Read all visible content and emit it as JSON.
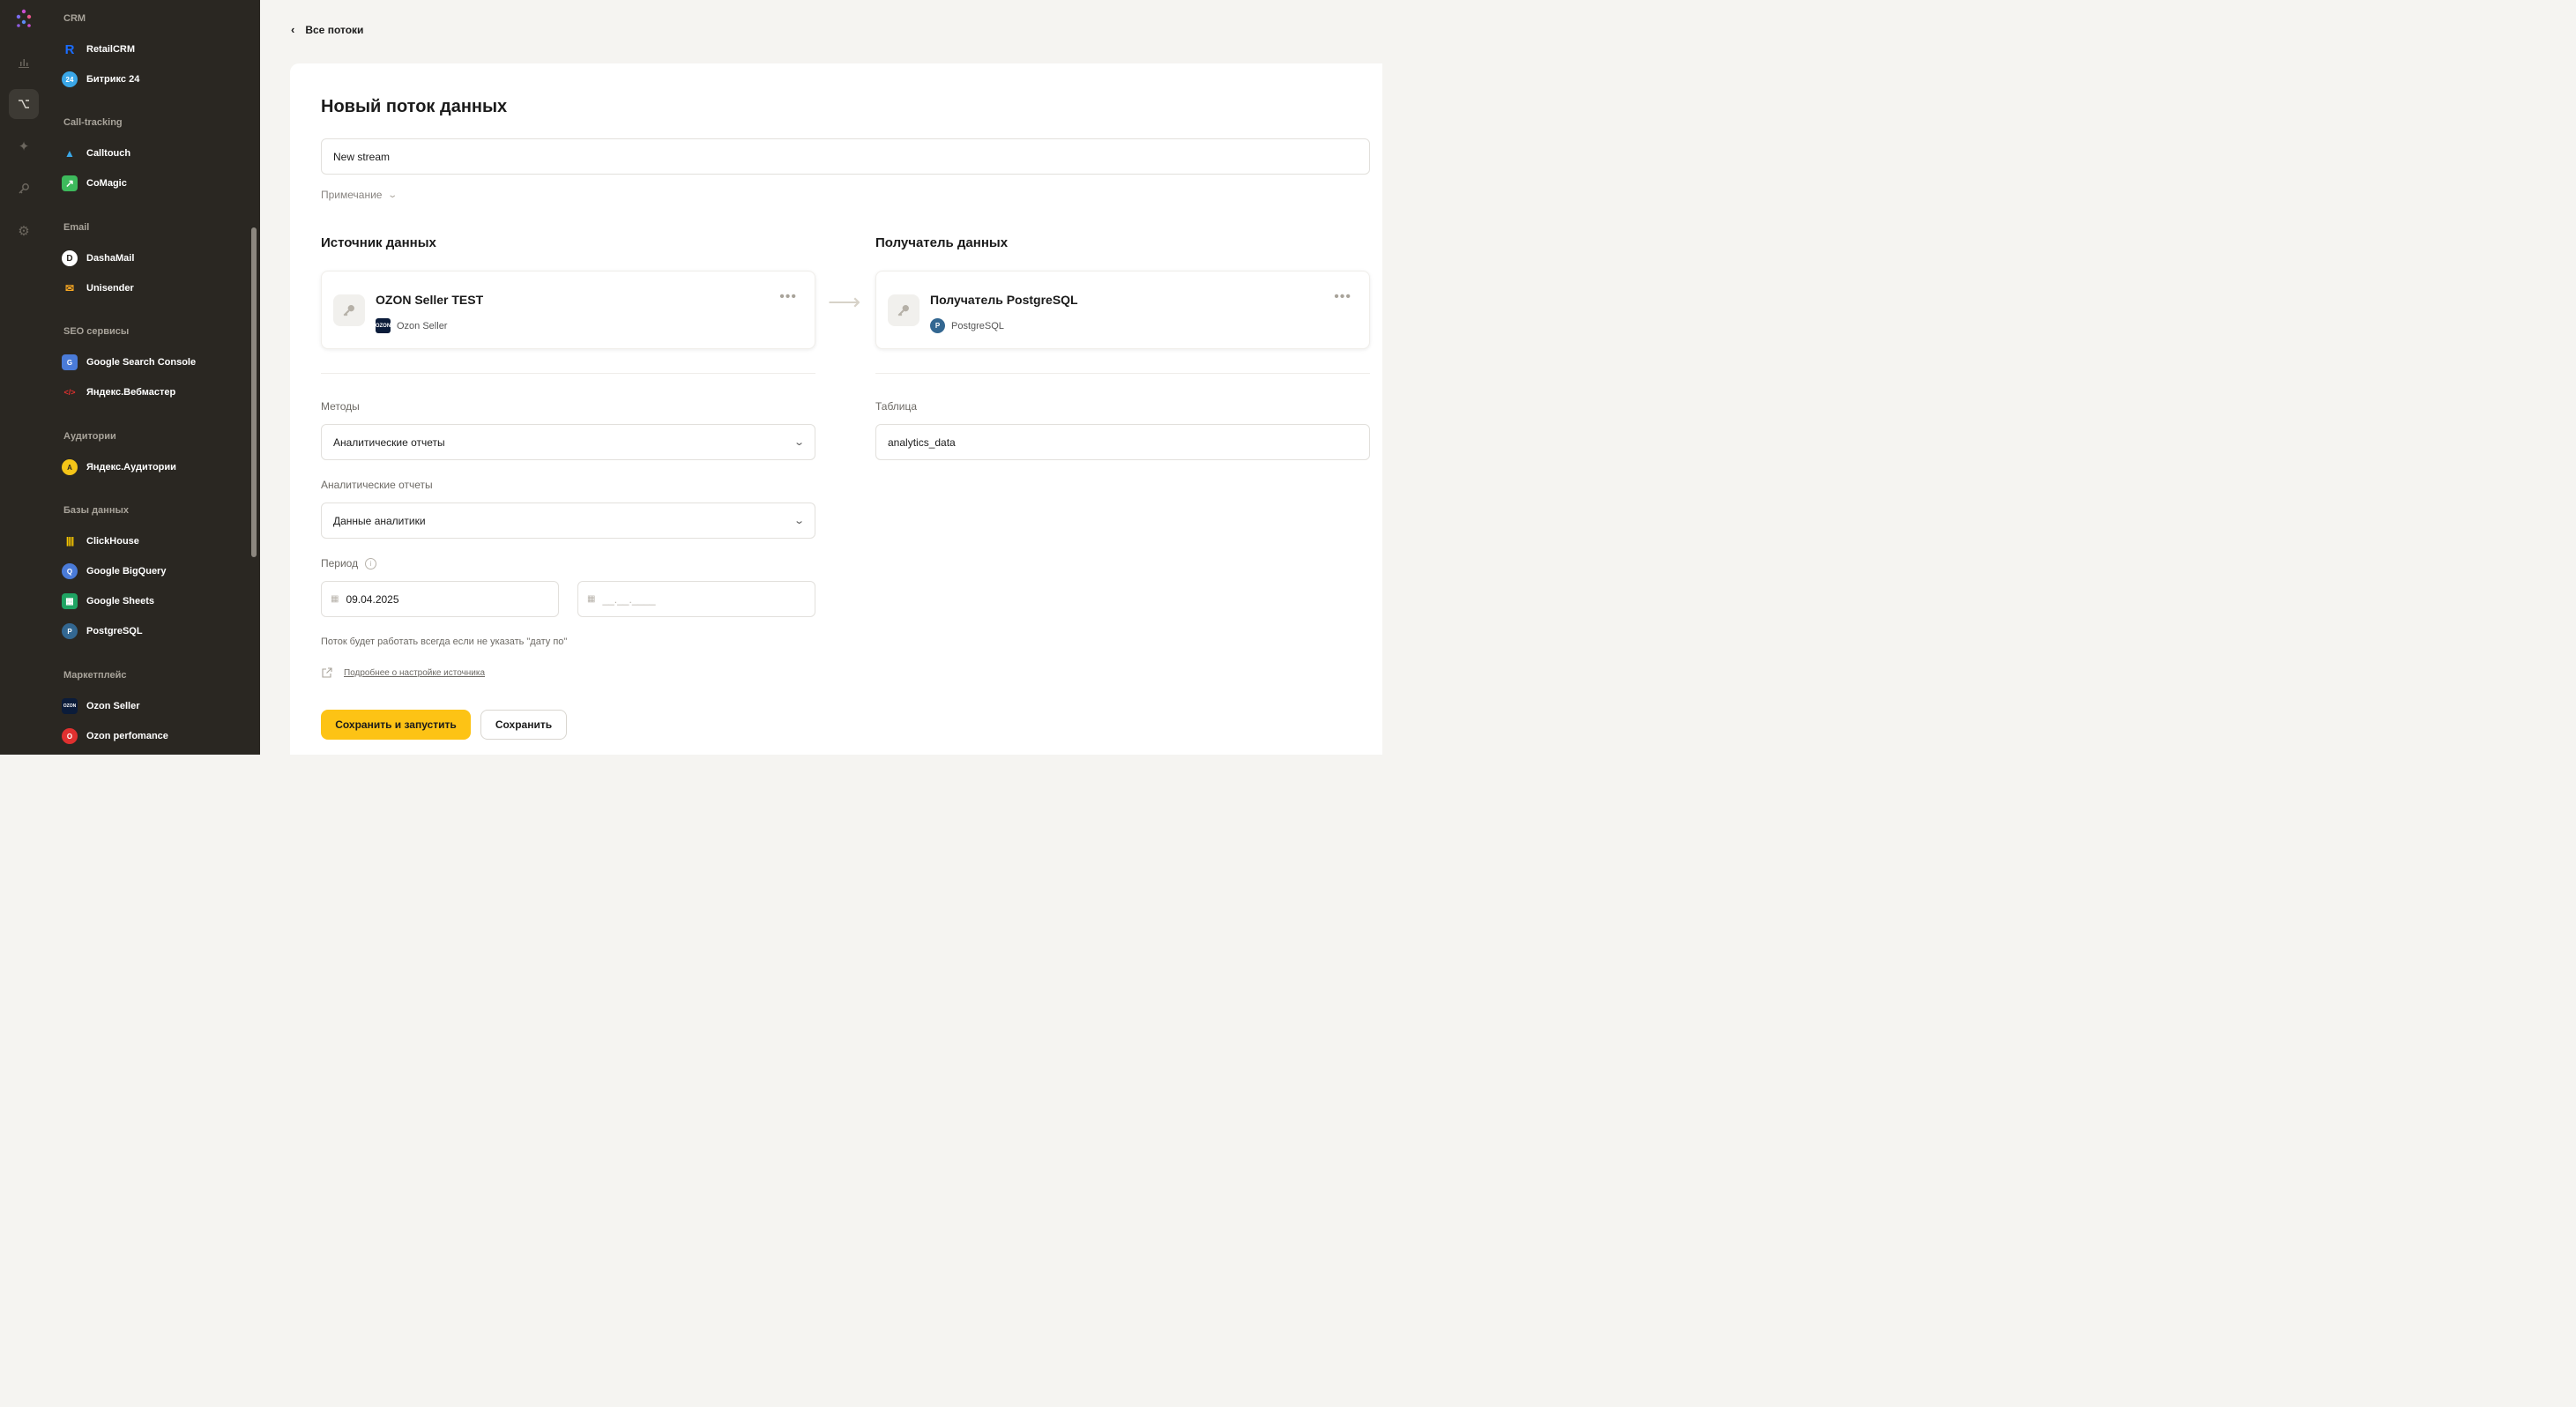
{
  "rail": {
    "icons": [
      "logo-icon",
      "bar-chart-icon",
      "flows-icon",
      "sparkle-icon",
      "key-icon",
      "gear-icon"
    ]
  },
  "sidebar": {
    "sections": [
      {
        "title": "CRM",
        "items": [
          {
            "label": "RetailCRM",
            "logo_text": "R",
            "color": "#1a6cff"
          },
          {
            "label": "Битрикс 24",
            "logo_text": "24",
            "color": "#3aa7e8"
          }
        ]
      },
      {
        "title": "Call-tracking",
        "items": [
          {
            "label": "Calltouch",
            "logo_text": "▲",
            "color": "#2a2722"
          },
          {
            "label": "CoMagic",
            "logo_text": "↗",
            "color": "#3dba5c"
          }
        ]
      },
      {
        "title": "Email",
        "items": [
          {
            "label": "DashaMail",
            "logo_text": "D",
            "color": "#ffffff"
          },
          {
            "label": "Unisender",
            "logo_text": "✉",
            "color": "#f5a623"
          }
        ]
      },
      {
        "title": "SEO сервисы",
        "items": [
          {
            "label": "Google Search Console",
            "logo_text": "G",
            "color": "#4a7bd8"
          },
          {
            "label": "Яндекс.Вебмастер",
            "logo_text": "</>",
            "color": "#e0302f"
          }
        ]
      },
      {
        "title": "Аудитории",
        "items": [
          {
            "label": "Яндекс.Аудитории",
            "logo_text": "A",
            "color": "#f5c518"
          }
        ]
      },
      {
        "title": "Базы данных",
        "items": [
          {
            "label": "ClickHouse",
            "logo_text": "||||",
            "color": "#f7c600"
          },
          {
            "label": "Google BigQuery",
            "logo_text": "Q",
            "color": "#4a7bd8"
          },
          {
            "label": "Google Sheets",
            "logo_text": "▦",
            "color": "#1fa463"
          },
          {
            "label": "PostgreSQL",
            "logo_text": "P",
            "color": "#336791"
          }
        ]
      },
      {
        "title": "Маркетплейс",
        "items": [
          {
            "label": "Ozon Seller",
            "logo_text": "OZON",
            "color": "#0b1c3a"
          },
          {
            "label": "Ozon perfomance",
            "logo_text": "O",
            "color": "#e0302f"
          }
        ]
      }
    ]
  },
  "header": {
    "back_label": "Все потоки"
  },
  "form": {
    "title": "Новый поток данных",
    "name_value": "New stream",
    "note_label": "Примечание",
    "source_heading": "Источник данных",
    "dest_heading": "Получатель данных",
    "source": {
      "name": "OZON Seller TEST",
      "type": "Ozon Seller"
    },
    "dest": {
      "name": "Получатель PostgreSQL",
      "type": "PostgreSQL"
    },
    "methods_label": "Методы",
    "methods_value": "Аналитические отчеты",
    "reports_label": "Аналитические отчеты",
    "reports_value": "Данные аналитики",
    "period_label": "Период",
    "date_from": "09.04.2025",
    "date_to_placeholder": "__.__.____",
    "table_label": "Таблица",
    "table_value": "analytics_data",
    "hint": "Поток будет работать всегда если не указать \"дату по\"",
    "more_link": "Подробнее о настройке источника",
    "save_run_label": "Сохранить и запустить",
    "save_label": "Сохранить"
  },
  "colors": {
    "accent": "#fdc315",
    "sidebar_bg": "#2a2722",
    "page_bg": "#f5f4f1"
  }
}
